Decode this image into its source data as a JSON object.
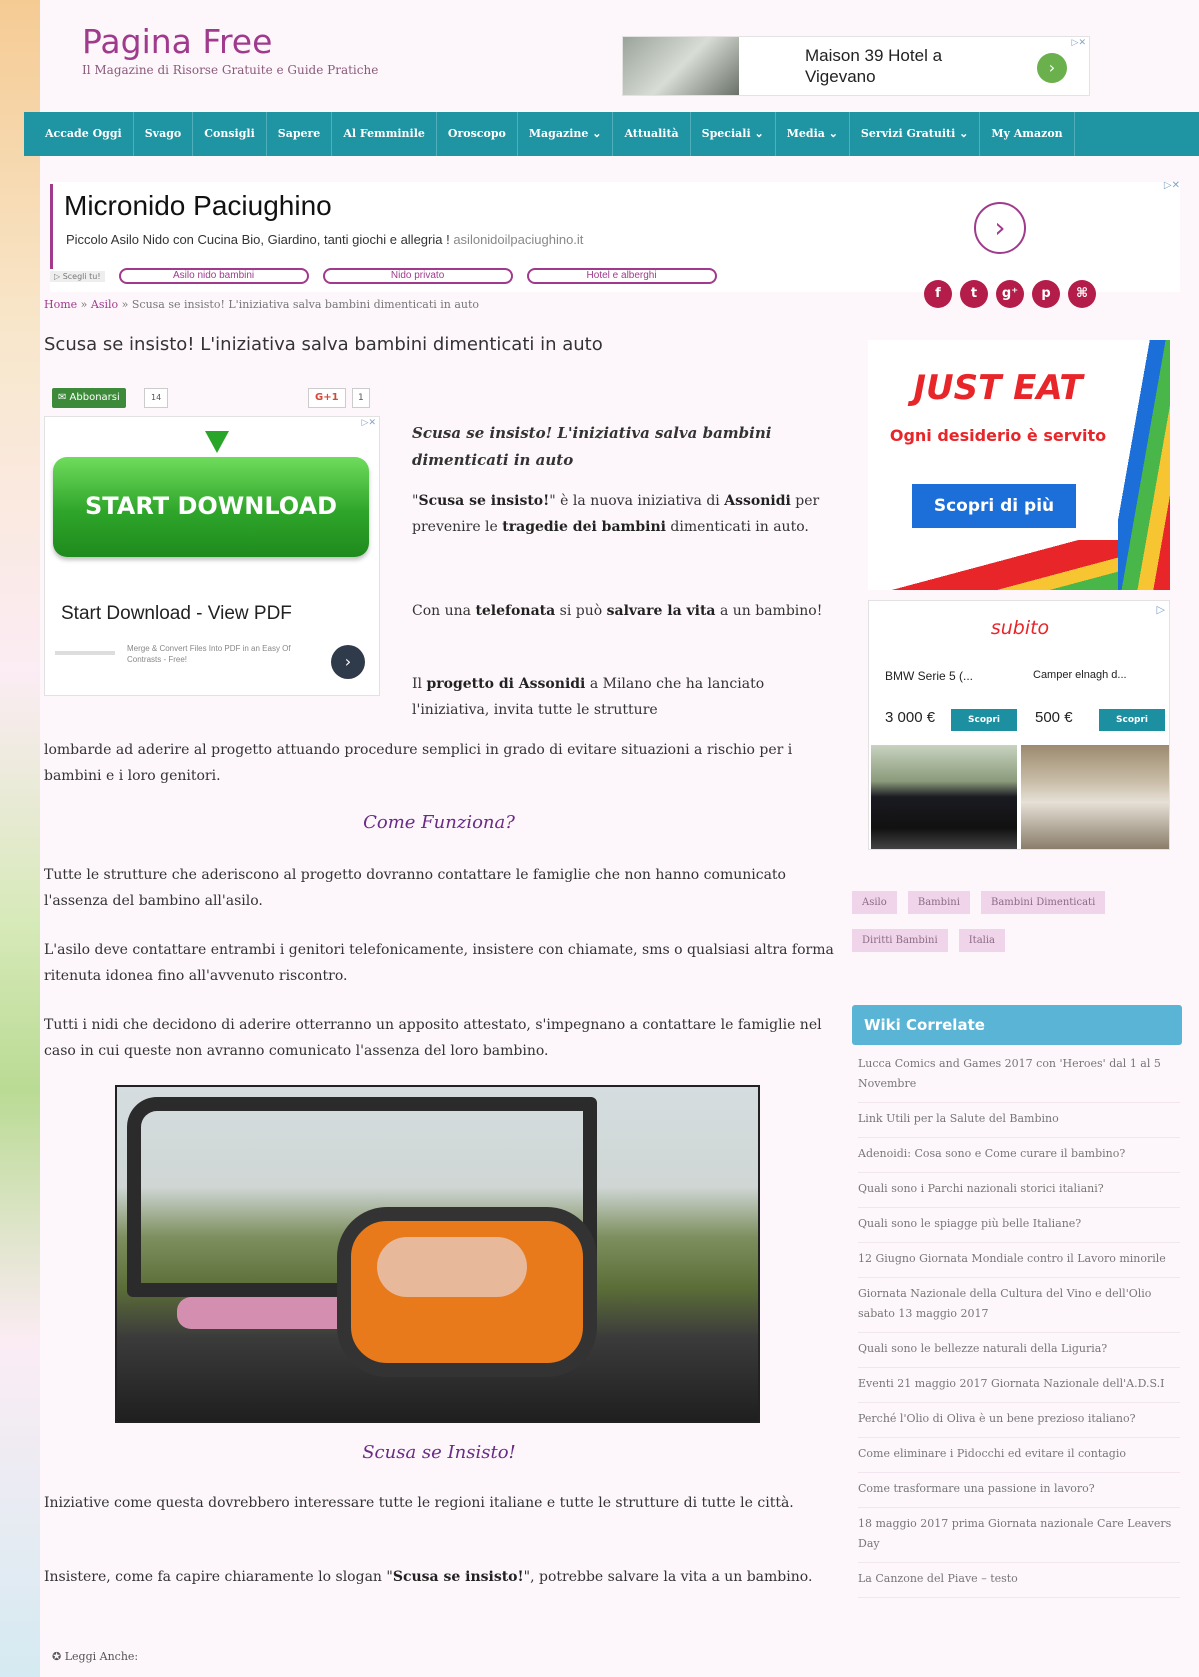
{
  "header": {
    "logo_title": "Pagina Free",
    "logo_subtitle": "Il Magazine di Risorse Gratuite e Guide Pratiche",
    "top_ad": {
      "text": "Maison 39 Hotel a Vigevano",
      "arrow": "›",
      "adchoice": "▷✕"
    }
  },
  "nav": {
    "items": [
      "Accade Oggi",
      "Svago",
      "Consigli",
      "Sapere",
      "Al Femminile",
      "Oroscopo",
      "Magazine ⌄",
      "Attualità",
      "Speciali ⌄",
      "Media ⌄",
      "Servizi Gratuiti ⌄",
      "My Amazon"
    ]
  },
  "ad2": {
    "title": "Micronido Paciughino",
    "desc": "Piccolo Asilo Nido con Cucina Bio, Giardino, tanti giochi e allegria !",
    "domain": "asilonidoilpaciughino.it",
    "circle": "›",
    "adchoice": "▷✕",
    "scegli": "▷ Scegli tu!",
    "pills": [
      "Asilo nido bambini",
      "Nido privato",
      "Hotel e alberghi"
    ]
  },
  "breadcrumb": {
    "home": "Home",
    "sep": "»",
    "cat": "Asilo",
    "current": "Scusa se insisto! L'iniziativa salva bambini dimenticati in auto"
  },
  "social": [
    "f",
    "t",
    "g⁺",
    "p",
    "⌘"
  ],
  "post": {
    "title": "Scusa se insisto! L'iniziativa salva bambini dimenticati in auto",
    "share": {
      "abbonarsi": "✉ Abbonarsi",
      "abbonarsi_count": "14",
      "gplus": "G+1",
      "gplus_count": "1"
    }
  },
  "dl_ad": {
    "button": "START DOWNLOAD",
    "title": "Start Download - View PDF",
    "small": "Merge & Convert Files Into PDF in an Easy Of Contrasts - Free!",
    "circle": "›",
    "adchoice": "▷✕"
  },
  "article": {
    "lead": "Scusa se insisto! L'iniziativa salva bambini dimenticati in auto",
    "p1_a": "\"",
    "p1_b": "Scusa se insisto!",
    "p1_c": "\" è la nuova iniziativa di ",
    "p1_d": "Assonidi",
    "p1_e": " per prevenire le ",
    "p1_f": "tragedie dei bambini",
    "p1_g": " dimenticati in auto.",
    "p2_a": "Con una ",
    "p2_b": "telefonata",
    "p2_c": " si può ",
    "p2_d": "salvare la vita",
    "p2_e": " a un bambino!",
    "p3_a": "Il ",
    "p3_b": "progetto di Assonidi",
    "p3_c": " a Milano che ha lanciato l'iniziativa, invita tutte le strutture",
    "p3_d": "lombarde ad aderire al progetto attuando procedure semplici in grado di evitare situazioni a rischio per i bambini e i loro genitori.",
    "h_come": "Come Funziona?",
    "p4": "Tutte le strutture che aderiscono al progetto dovranno contattare le famiglie che non hanno comunicato l'assenza del bambino all'asilo.",
    "p5": "L'asilo deve contattare entrambi i genitori telefonicamente, insistere con chiamate, sms o qualsiasi altra forma ritenuta idonea fino all'avvenuto riscontro.",
    "p6": "Tutti i nidi che decidono di aderire otterranno un apposito attestato, s'impegnano a contattare le famiglie nel caso in cui queste non avranno comunicato l'assenza del loro bambino.",
    "h_scusa": "Scusa se Insisto!",
    "p7": "Iniziative come questa dovrebbero interessare tutte le regioni italiane e tutte le strutture di tutte le città.",
    "p8_a": "Insistere, come fa capire chiaramente lo slogan \"",
    "p8_b": "Scusa se insisto!",
    "p8_c": "\", potrebbe salvare la vita a un bambino.",
    "leggi": "✪  Leggi Anche:"
  },
  "sidebar": {
    "just_eat": {
      "title": "JUST EAT",
      "sub": "Ogni desiderio è servito",
      "btn": "Scopri di più"
    },
    "subito": {
      "logo": "subito",
      "adchoice": "▷",
      "item1": "BMW Serie 5 (...",
      "item2": "Camper elnagh d...",
      "price1": "3 000 €",
      "price2": "500 €",
      "btn": "Scopri"
    },
    "tags": [
      "Asilo",
      "Bambini",
      "Bambini Dimenticati",
      "Diritti Bambini",
      "Italia"
    ],
    "wiki_title": "Wiki Correlate",
    "wiki": [
      "Lucca Comics and Games 2017 con 'Heroes' dal 1 al 5 Novembre",
      "Link Utili per la Salute del Bambino",
      "Adenoidi: Cosa sono e Come curare il bambino?",
      "Quali sono i Parchi nazionali storici italiani?",
      "Quali sono le spiagge più belle Italiane?",
      "12 Giugno Giornata Mondiale contro il Lavoro minorile",
      "Giornata Nazionale della Cultura del Vino e dell'Olio sabato 13 maggio 2017",
      "Quali sono le bellezze naturali della Liguria?",
      "Eventi 21 maggio 2017 Giornata Nazionale dell'A.D.S.I",
      "Perché l'Olio di Oliva è un bene prezioso italiano?",
      "Come eliminare i Pidocchi ed evitare il contagio",
      "Come trasformare una passione in lavoro?",
      "18 maggio 2017 prima Giornata nazionale Care Leavers Day",
      "La Canzone del Piave – testo"
    ]
  },
  "colors": {
    "brand": "#a03a8c",
    "nav": "#1f94a3",
    "accent_heading": "#6a2a86",
    "wiki_header": "#5ab4d6"
  }
}
